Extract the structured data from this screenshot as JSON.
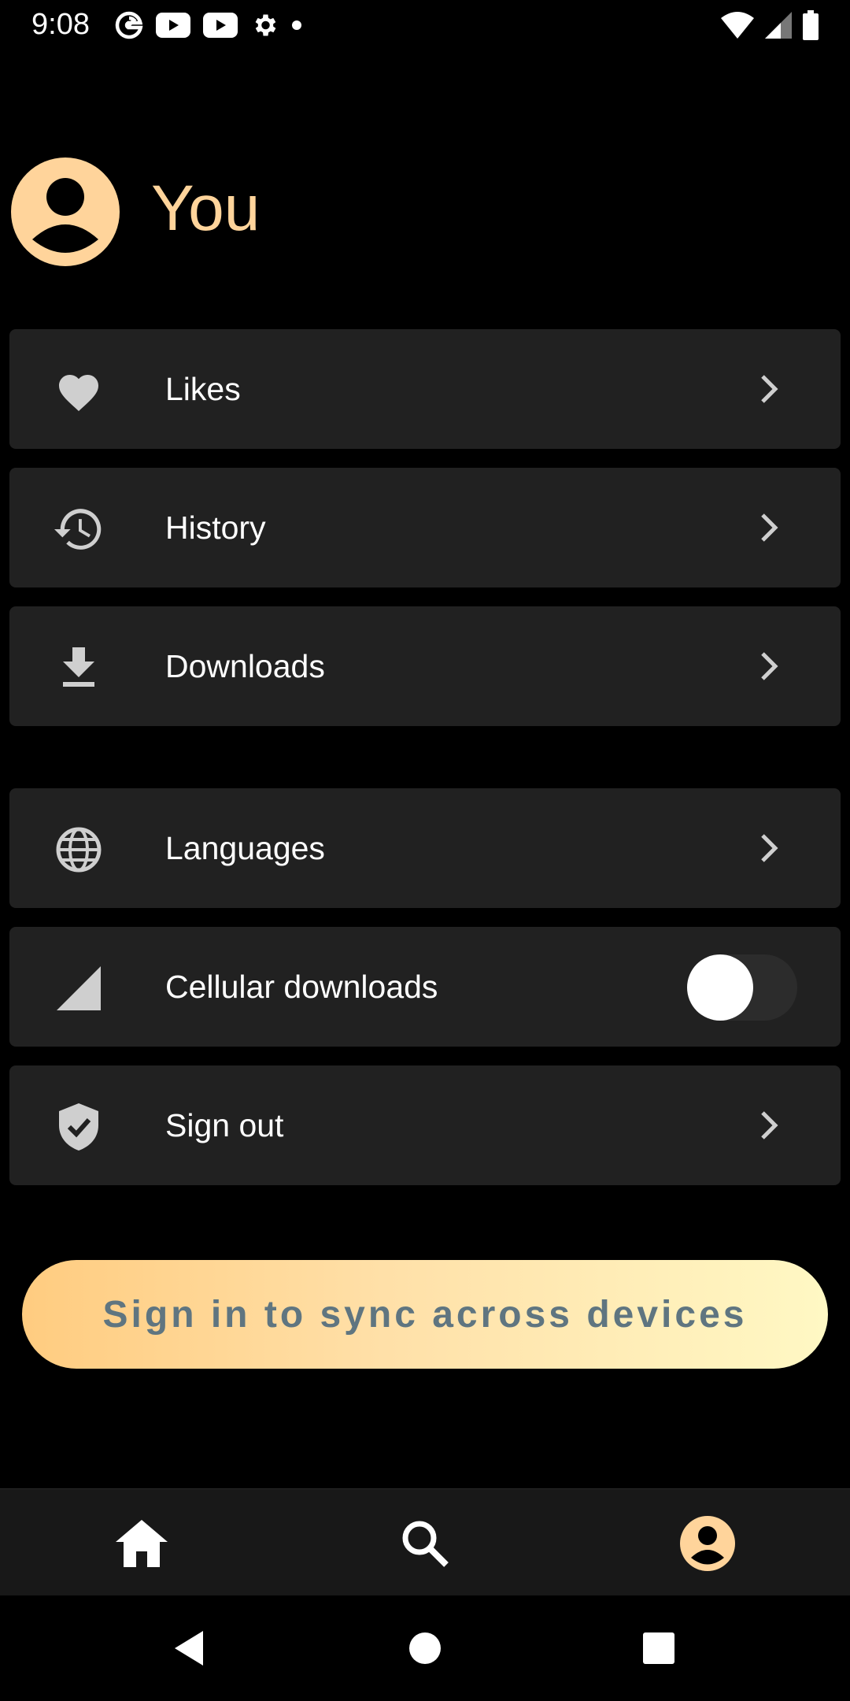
{
  "status_bar": {
    "time": "9:08",
    "left_icons": [
      "google-icon",
      "youtube-icon",
      "youtube-icon",
      "gear-icon",
      "dot-icon"
    ],
    "right_icons": [
      "wifi-icon",
      "signal-icon",
      "battery-icon"
    ]
  },
  "profile": {
    "title": "You",
    "accent_color": "#ffd49b"
  },
  "menu": {
    "likes": {
      "label": "Likes",
      "icon": "heart-icon"
    },
    "history": {
      "label": "History",
      "icon": "history-icon"
    },
    "downloads": {
      "label": "Downloads",
      "icon": "download-icon"
    },
    "languages": {
      "label": "Languages",
      "icon": "globe-icon"
    },
    "cellular": {
      "label": "Cellular downloads",
      "icon": "cell-signal-icon",
      "toggle_on": false
    },
    "sign_out": {
      "label": "Sign out",
      "icon": "shield-check-icon"
    }
  },
  "signin": {
    "label": "Sign in to sync across devices"
  },
  "bottom_nav": {
    "items": [
      "home-icon",
      "search-icon",
      "account-icon"
    ],
    "active": "account-icon"
  },
  "system_nav": {
    "items": [
      "back-icon",
      "home-circle-icon",
      "recents-icon"
    ]
  },
  "colors": {
    "background": "#000000",
    "card": "#212121",
    "gradient_start": "#ffcc80",
    "gradient_end": "#fff8c4",
    "signin_text": "#5f7580"
  }
}
